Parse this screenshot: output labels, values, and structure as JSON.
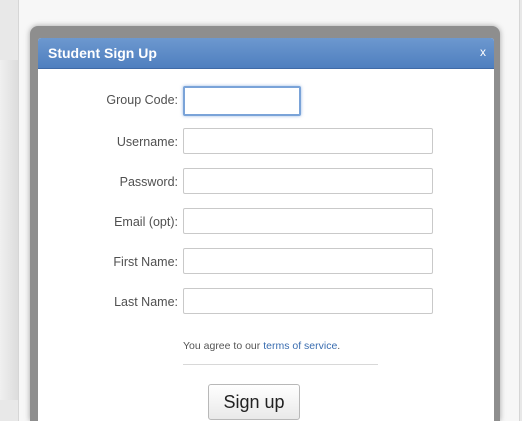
{
  "dialog": {
    "title": "Student Sign Up",
    "close_label": "x"
  },
  "form": {
    "fields": [
      {
        "label": "Group Code:",
        "value": ""
      },
      {
        "label": "Username:",
        "value": ""
      },
      {
        "label": "Password:",
        "value": ""
      },
      {
        "label": "Email (opt):",
        "value": ""
      },
      {
        "label": "First Name:",
        "value": ""
      },
      {
        "label": "Last Name:",
        "value": ""
      }
    ],
    "terms_prefix": "You agree to our ",
    "terms_link": "terms of service",
    "terms_suffix": ".",
    "submit_label": "Sign up"
  },
  "colors": {
    "title_bar": "#4f7fbf",
    "focus_border": "#7aa3d8",
    "link": "#3a6db0"
  }
}
